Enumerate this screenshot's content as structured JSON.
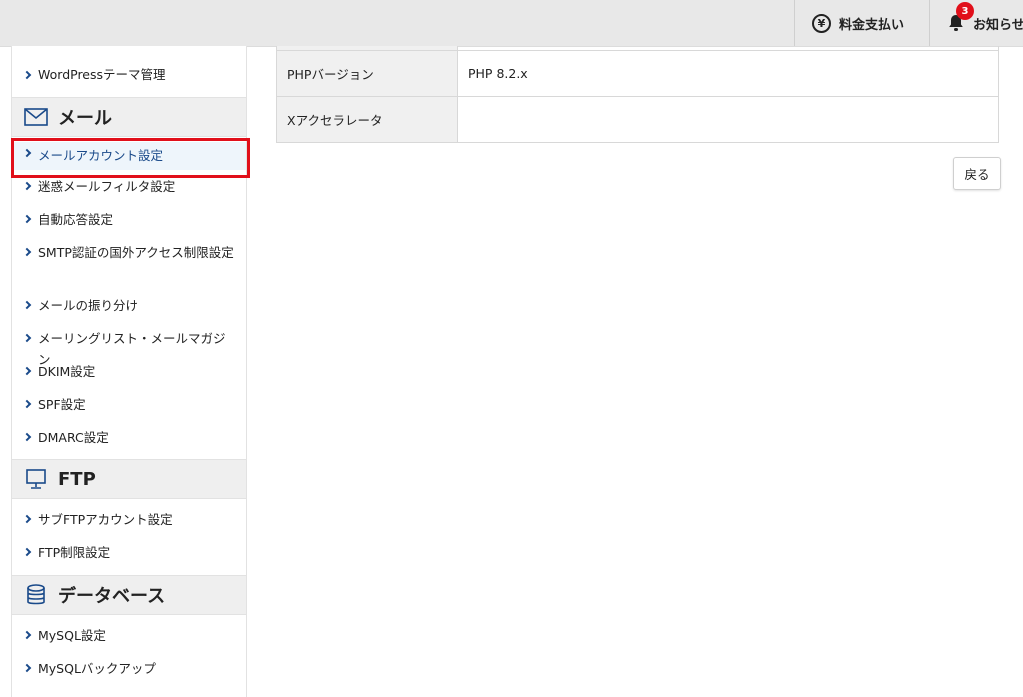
{
  "header": {
    "billing_label": "料金支払い",
    "billing_icon": "yen-icon",
    "notice_label": "お知らせ",
    "notice_icon": "bell-icon",
    "notice_count": "3"
  },
  "sidebar": {
    "top_item": "WordPressテーマ管理",
    "mail": {
      "title": "メール",
      "icon": "envelope-icon",
      "items": [
        "メールアカウント設定",
        "迷惑メールフィルタ設定",
        "自動応答設定",
        "SMTP認証の国外アクセス制限設定",
        "メールの振り分け",
        "メーリングリスト・メールマガジン",
        "DKIM設定",
        "SPF設定",
        "DMARC設定"
      ]
    },
    "ftp": {
      "title": "FTP",
      "icon": "monitor-icon",
      "items": [
        "サブFTPアカウント設定",
        "FTP制限設定"
      ]
    },
    "database": {
      "title": "データベース",
      "icon": "database-icon",
      "items": [
        "MySQL設定",
        "MySQLバックアップ"
      ]
    }
  },
  "main": {
    "rows": [
      {
        "label": "PHPバージョン",
        "value": "PHP 8.2.x"
      },
      {
        "label": "Xアクセラレータ",
        "value": ""
      }
    ],
    "back_label": "戻る"
  },
  "colors": {
    "accent": "#1a4a8a",
    "highlight": "#e10f1a",
    "badge": "#e10f1a"
  }
}
